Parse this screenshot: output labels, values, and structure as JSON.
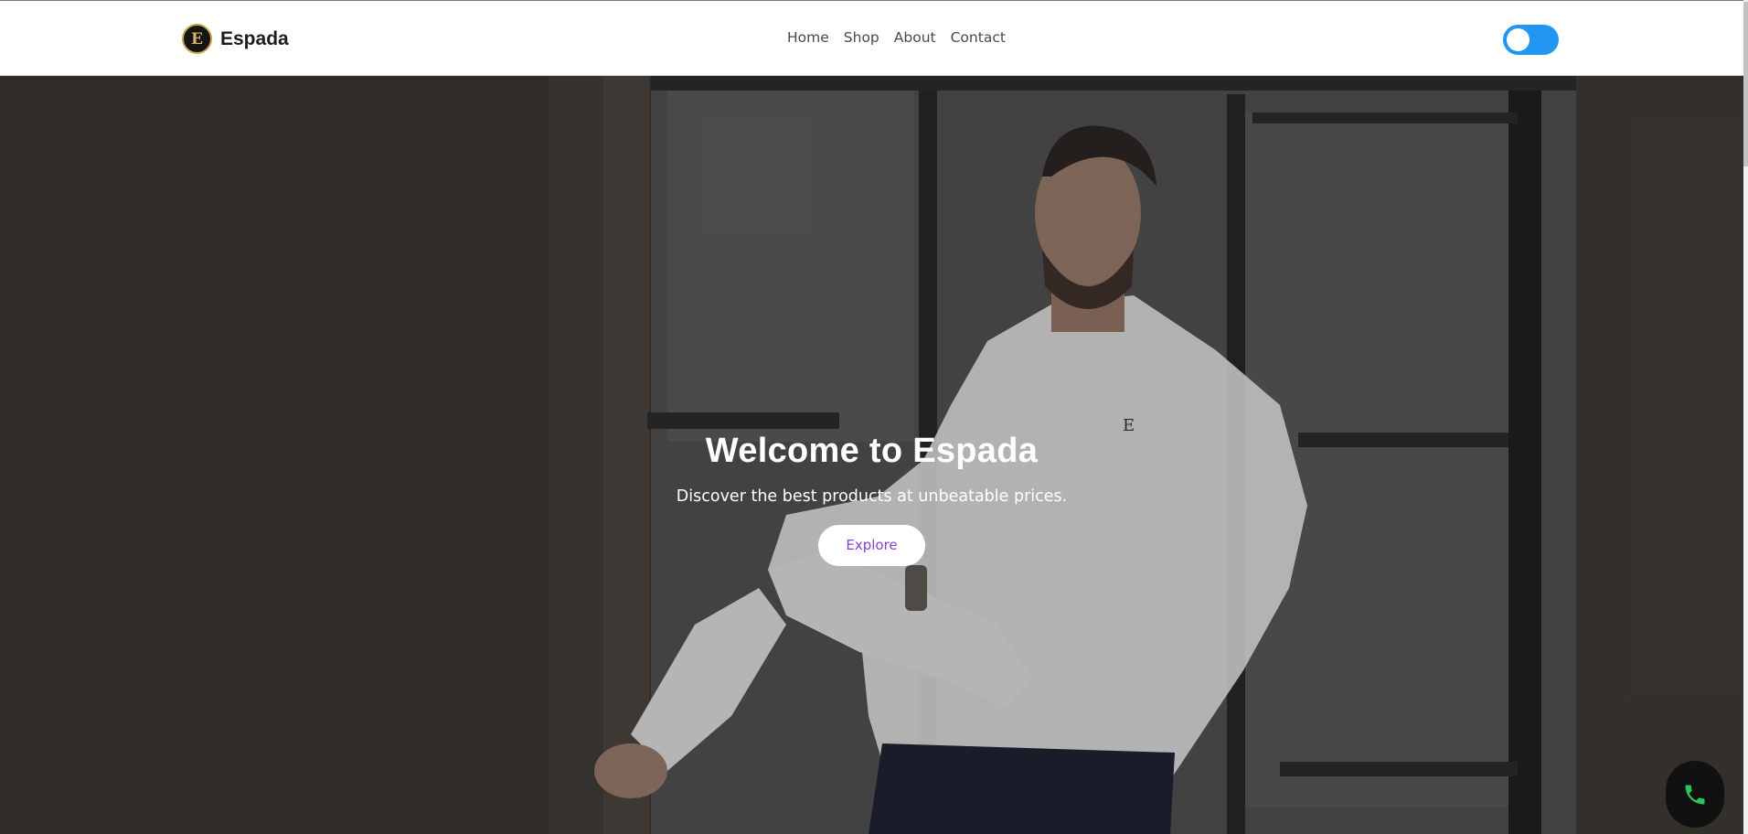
{
  "brand": {
    "logo_letter": "E",
    "name": "Espada"
  },
  "nav": {
    "items": [
      "Home",
      "Shop",
      "About",
      "Contact"
    ]
  },
  "theme_toggle": {
    "state": "off",
    "track_color": "#2196f3"
  },
  "hero": {
    "title": "Welcome to Espada",
    "subtitle": "Discover the best products at unbeatable prices.",
    "cta_label": "Explore",
    "cta_text_color": "#8a3fd0"
  },
  "phone_button": {
    "icon": "phone-icon",
    "color": "#2ec35a"
  }
}
